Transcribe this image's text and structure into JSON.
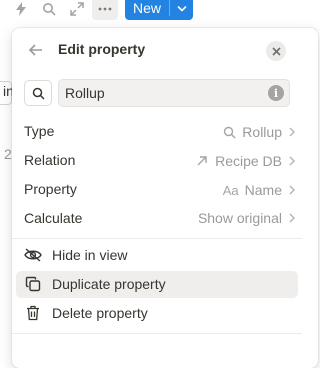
{
  "toolbar": {
    "icons": [
      "lightning-icon",
      "search-icon",
      "expand-icon",
      "more-icon"
    ],
    "new_button_label": "New"
  },
  "background_fragments": {
    "left_text_1": "in",
    "left_text_2": "2"
  },
  "popup": {
    "title": "Edit property",
    "name_input_value": "Rollup",
    "rows": [
      {
        "label": "Type",
        "value": "Rollup",
        "icon": "search-icon"
      },
      {
        "label": "Relation",
        "value": "Recipe DB",
        "icon": "arrow-up-right-icon"
      },
      {
        "label": "Property",
        "value": "Name",
        "icon_text": "Aa"
      },
      {
        "label": "Calculate",
        "value": "Show original"
      }
    ],
    "actions": [
      {
        "label": "Hide in view",
        "icon": "eye-slash-icon"
      },
      {
        "label": "Duplicate property",
        "icon": "duplicate-icon",
        "highlighted": true
      },
      {
        "label": "Delete property",
        "icon": "trash-icon"
      }
    ]
  }
}
